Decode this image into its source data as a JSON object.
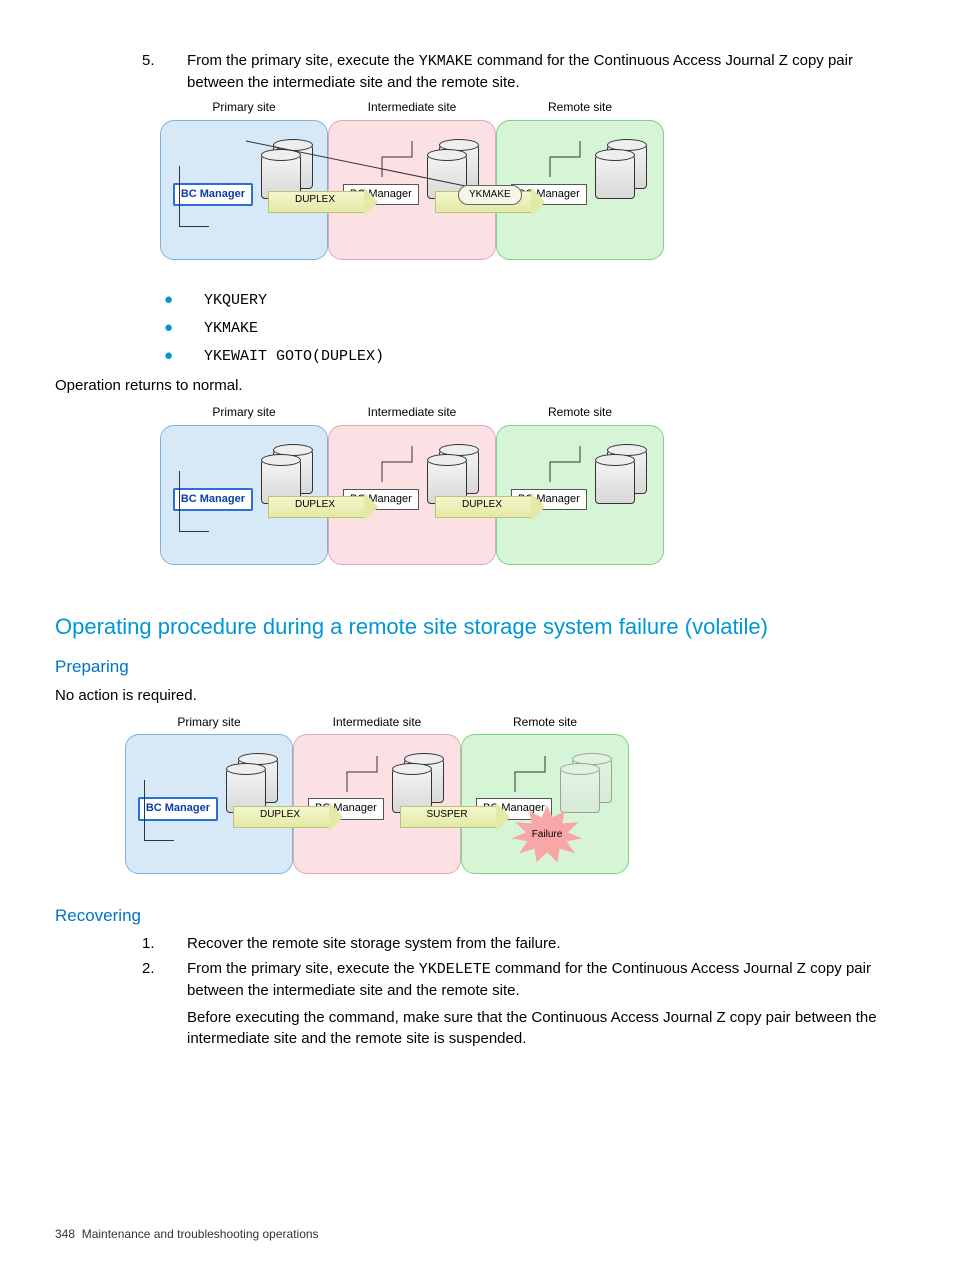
{
  "step5": {
    "num": "5.",
    "text_a": "From the primary site, execute the ",
    "cmd": "YKMAKE",
    "text_b": " command for the Continuous Access Journal Z copy pair between the intermediate site and the remote site."
  },
  "diagram1": {
    "primary_label": "Primary site",
    "intermediate_label": "Intermediate site",
    "remote_label": "Remote site",
    "bc_manager": "BC Manager",
    "duplex": "DUPLEX",
    "ykmake": "YKMAKE"
  },
  "bullets": {
    "b1": "YKQUERY",
    "b2": "YKMAKE",
    "b3": "YKEWAIT GOTO(DUPLEX)"
  },
  "return_normal": "Operation returns to normal.",
  "diagram2": {
    "primary_label": "Primary site",
    "intermediate_label": "Intermediate site",
    "remote_label": "Remote site",
    "bc_manager": "BC Manager",
    "duplex1": "DUPLEX",
    "duplex2": "DUPLEX"
  },
  "section_heading": "Operating procedure during a remote site storage system failure (volatile)",
  "preparing": {
    "heading": "Preparing",
    "text": "No action is required."
  },
  "diagram3": {
    "primary_label": "Primary site",
    "intermediate_label": "Intermediate site",
    "remote_label": "Remote site",
    "bc_manager": "BC Manager",
    "duplex": "DUPLEX",
    "susper": "SUSPER",
    "failure": "Failure"
  },
  "recovering": {
    "heading": "Recovering",
    "step1_num": "1.",
    "step1_text": "Recover the remote site storage system from the failure.",
    "step2_num": "2.",
    "step2_a": "From the primary site, execute the ",
    "step2_cmd": "YKDELETE",
    "step2_b": " command for the Continuous Access Journal Z copy pair between the intermediate site and the remote site.",
    "step2_para2": "Before executing the command, make sure that the Continuous Access Journal Z copy pair between the intermediate site and the remote site is suspended."
  },
  "footer": {
    "page": "348",
    "title": "Maintenance and troubleshooting operations"
  }
}
